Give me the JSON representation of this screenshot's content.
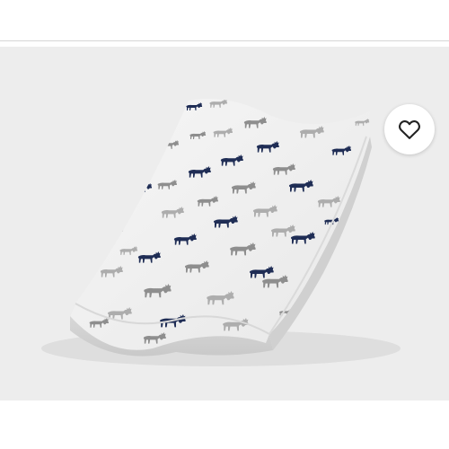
{
  "gallery": {
    "image": {
      "subject": "changing-pad-cover",
      "pattern_icon": "moose-icon",
      "pattern_colors": [
        "#1f2d55",
        "#8e8e8e",
        "#a9a9a9"
      ],
      "fabric_color": "#efefef",
      "background_color": "#ededed"
    },
    "favorite_button": {
      "icon": "heart-outline-icon",
      "icon_color": "#222222",
      "background_color": "#ffffff"
    }
  },
  "colors": {
    "divider": "#d6d6d6",
    "page_background": "#ffffff"
  }
}
